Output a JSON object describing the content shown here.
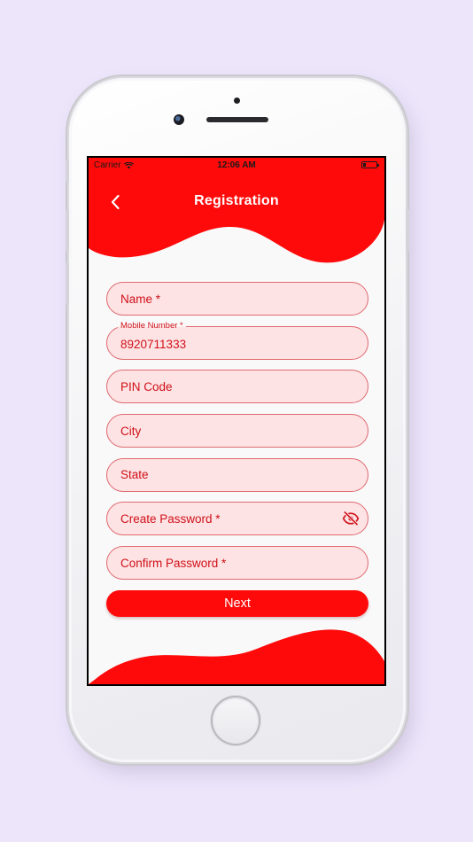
{
  "colors": {
    "accent": "#ff0a0a",
    "field_bg": "#fde3e4",
    "field_border": "#e06a70",
    "field_text": "#d01018"
  },
  "status_bar": {
    "carrier": "Carrier",
    "time": "12:06 AM"
  },
  "header": {
    "title": "Registration",
    "back_icon": "chevron-left-icon"
  },
  "form": {
    "name": {
      "placeholder": "Name *",
      "value": ""
    },
    "mobile": {
      "label": "Mobile Number *",
      "value": "8920711333"
    },
    "pin_code": {
      "placeholder": "PIN Code",
      "value": ""
    },
    "city": {
      "placeholder": "City",
      "value": ""
    },
    "state": {
      "placeholder": "State",
      "value": ""
    },
    "create_password": {
      "placeholder": "Create Password *",
      "value": "",
      "toggle_icon": "eye-off-icon"
    },
    "confirm_password": {
      "placeholder": "Confirm Password *",
      "value": ""
    },
    "next_label": "Next"
  }
}
